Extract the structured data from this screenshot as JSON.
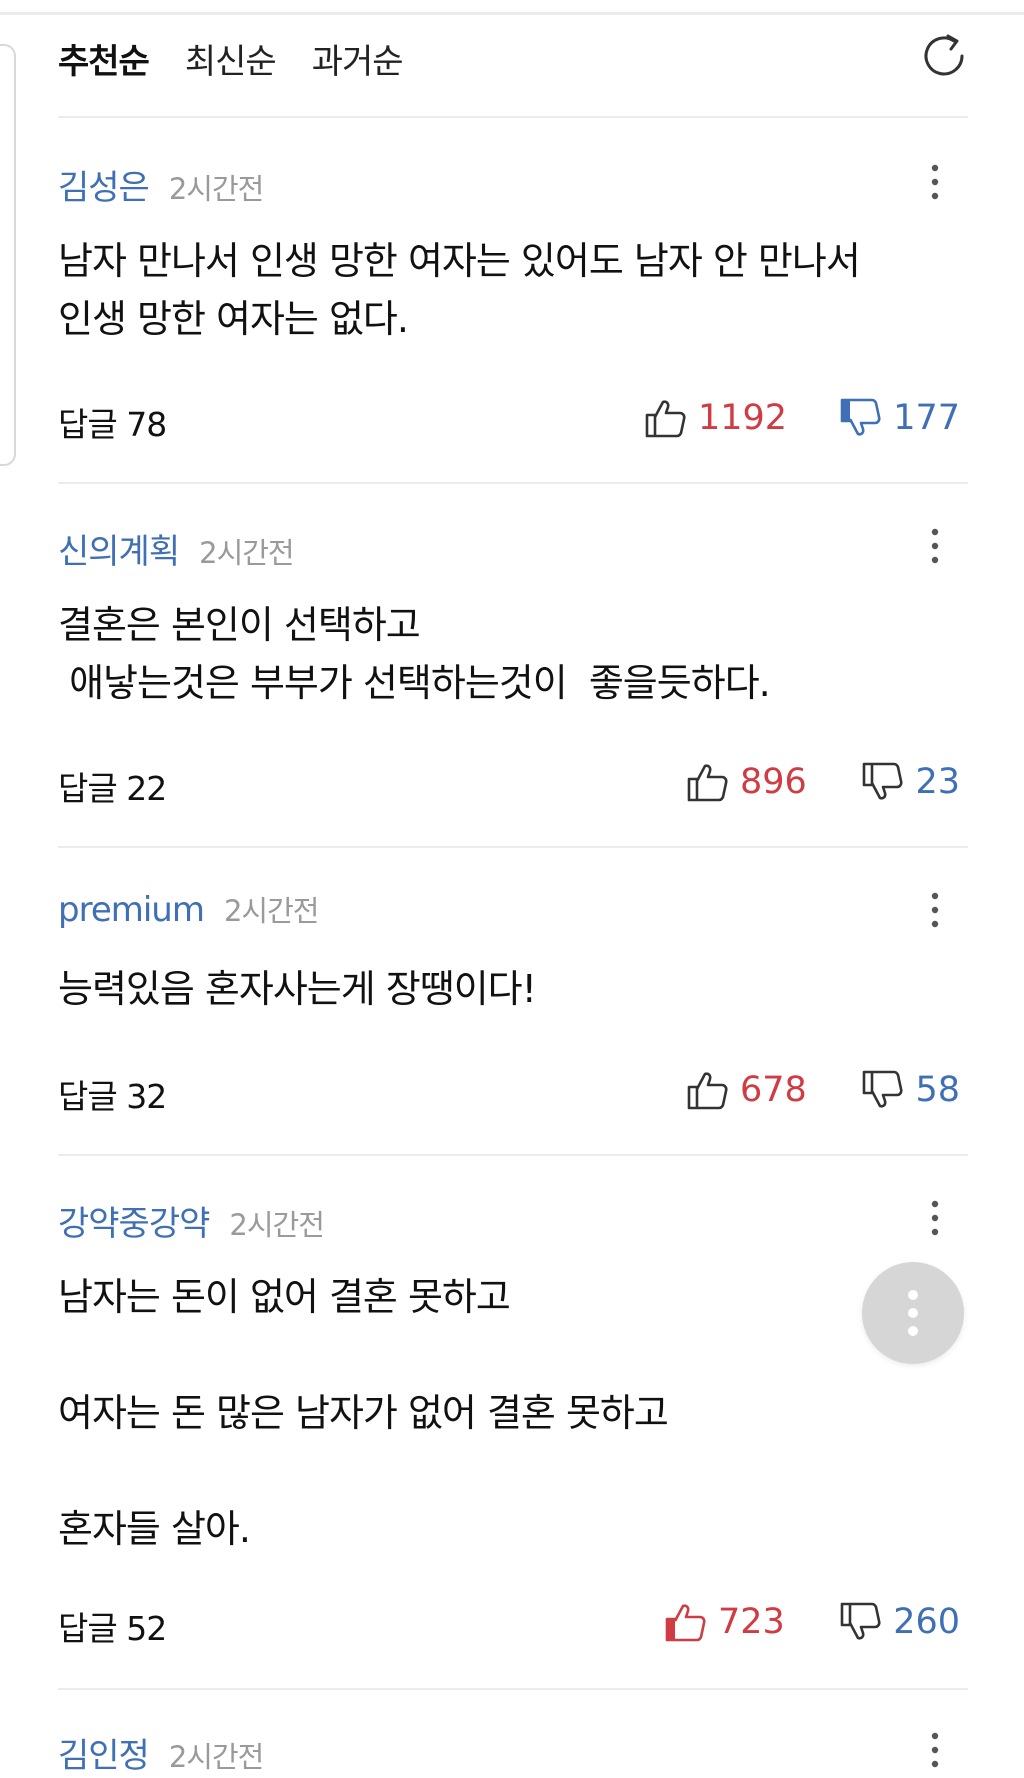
{
  "sort": {
    "tabs": [
      "추천순",
      "최신순",
      "과거순"
    ],
    "active": "추천순"
  },
  "comments": [
    {
      "author": "김성은",
      "time": "2시간전",
      "text": "남자 만나서 인생 망한 여자는 있어도 남자 안 만나서\n인생 망한 여자는 없다.",
      "reply": "답글 78",
      "likes": "1192",
      "dislikes": "177"
    },
    {
      "author": "신의계획",
      "time": "2시간전",
      "text": "결혼은 본인이 선택하고\n 애낳는것은 부부가 선택하는것이  좋을듯하다.",
      "reply": "답글 22",
      "likes": "896",
      "dislikes": "23"
    },
    {
      "author": "premium",
      "time": "2시간전",
      "text": "능력있음 혼자사는게 장땡이다!",
      "reply": "답글 32",
      "likes": "678",
      "dislikes": "58"
    },
    {
      "author": "강약중강약",
      "time": "2시간전",
      "text": "남자는 돈이 없어 결혼 못하고\n\n여자는 돈 많은 남자가 없어 결혼 못하고\n\n혼자들 살아.",
      "reply": "답글 52",
      "likes": "723",
      "dislikes": "260"
    },
    {
      "author": "김인정",
      "time": "2시간전"
    }
  ],
  "colors": {
    "author": "#3f6fb5",
    "like": "#d13b43",
    "dislike": "#3f6fb5",
    "time": "#9a9a9a"
  }
}
